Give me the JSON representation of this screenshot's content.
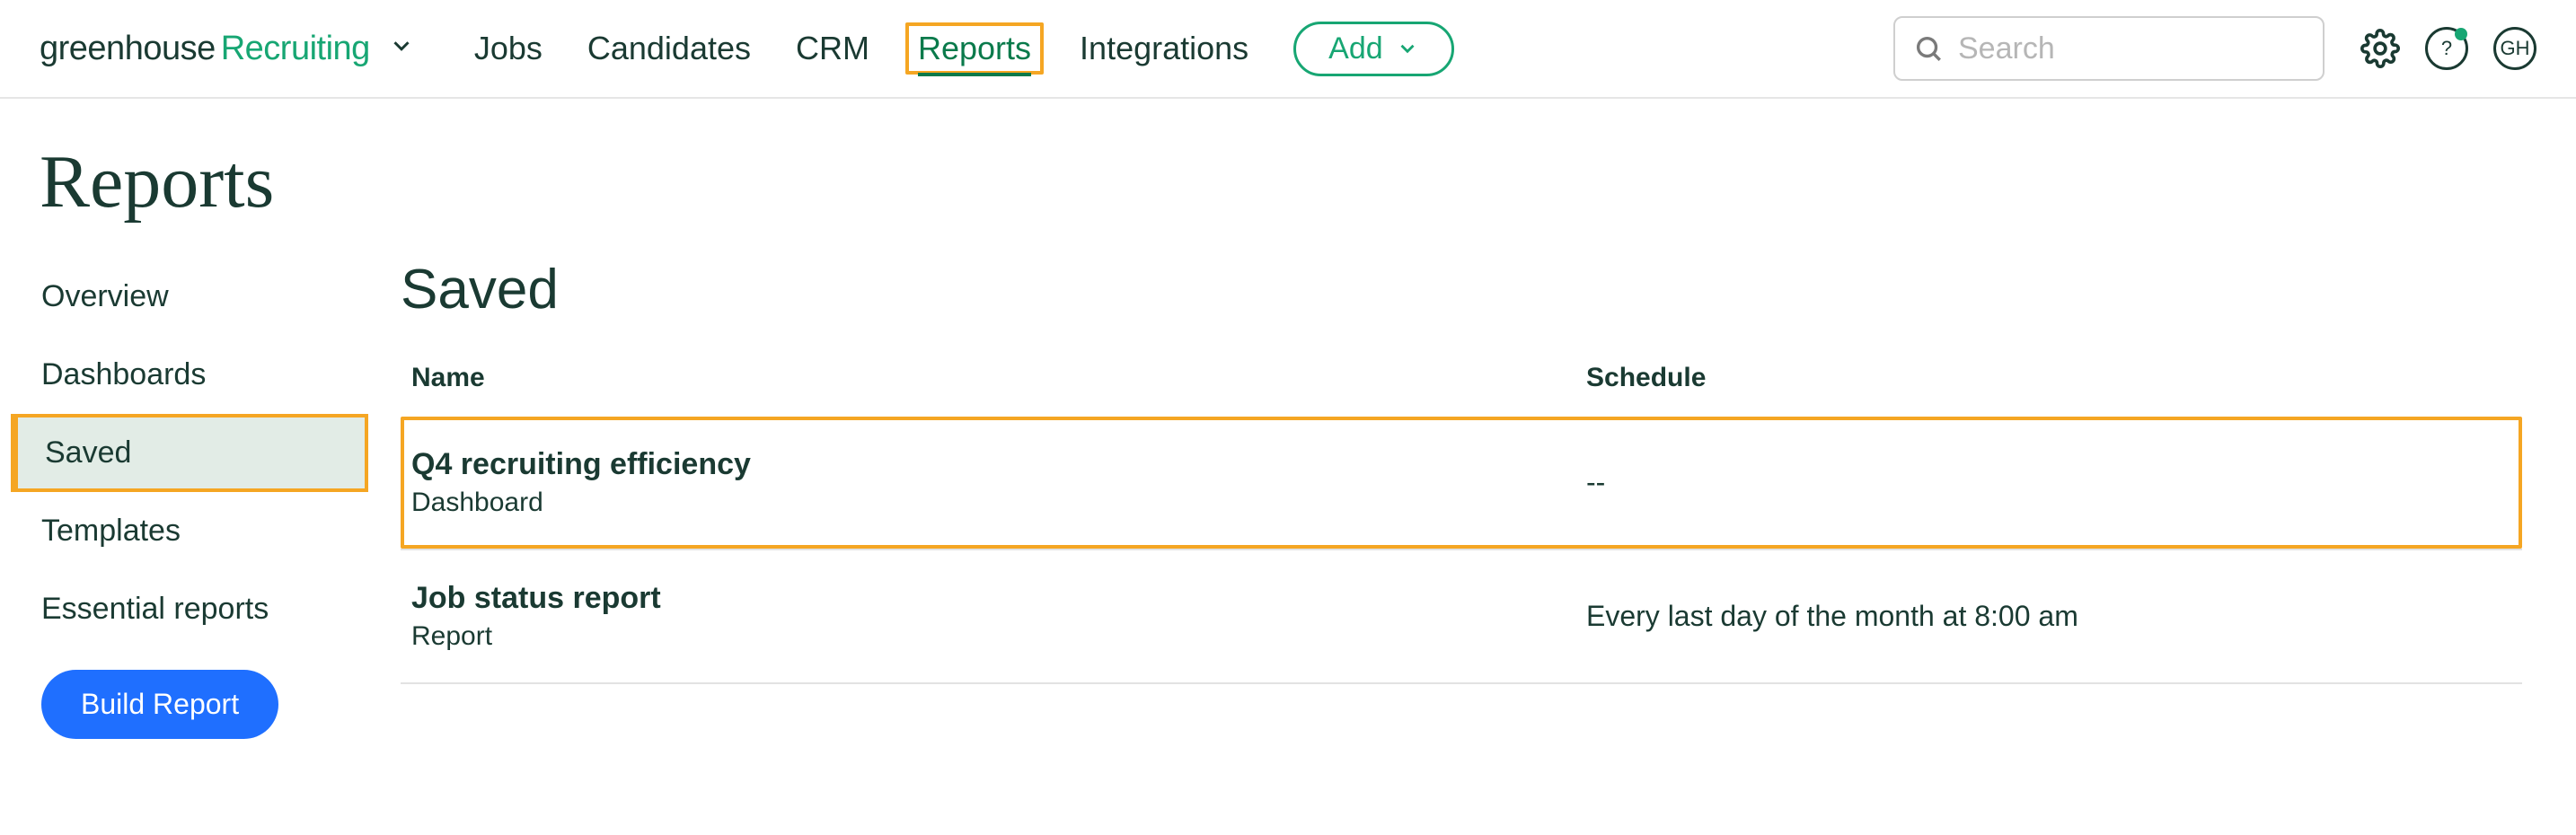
{
  "brand": {
    "word1": "greenhouse",
    "word2": "Recruiting"
  },
  "nav": {
    "jobs": "Jobs",
    "candidates": "Candidates",
    "crm": "CRM",
    "reports": "Reports",
    "integrations": "Integrations",
    "add": "Add"
  },
  "search": {
    "placeholder": "Search"
  },
  "avatar_initials": "GH",
  "page_title": "Reports",
  "sidebar": {
    "overview": "Overview",
    "dashboards": "Dashboards",
    "saved": "Saved",
    "templates": "Templates",
    "essential": "Essential reports",
    "build": "Build Report"
  },
  "section_heading": "Saved",
  "columns": {
    "name": "Name",
    "schedule": "Schedule"
  },
  "rows": [
    {
      "title": "Q4 recruiting efficiency",
      "subtitle": "Dashboard",
      "schedule": "--"
    },
    {
      "title": "Job status report",
      "subtitle": "Report",
      "schedule": "Every last day of the month at 8:00 am"
    }
  ]
}
